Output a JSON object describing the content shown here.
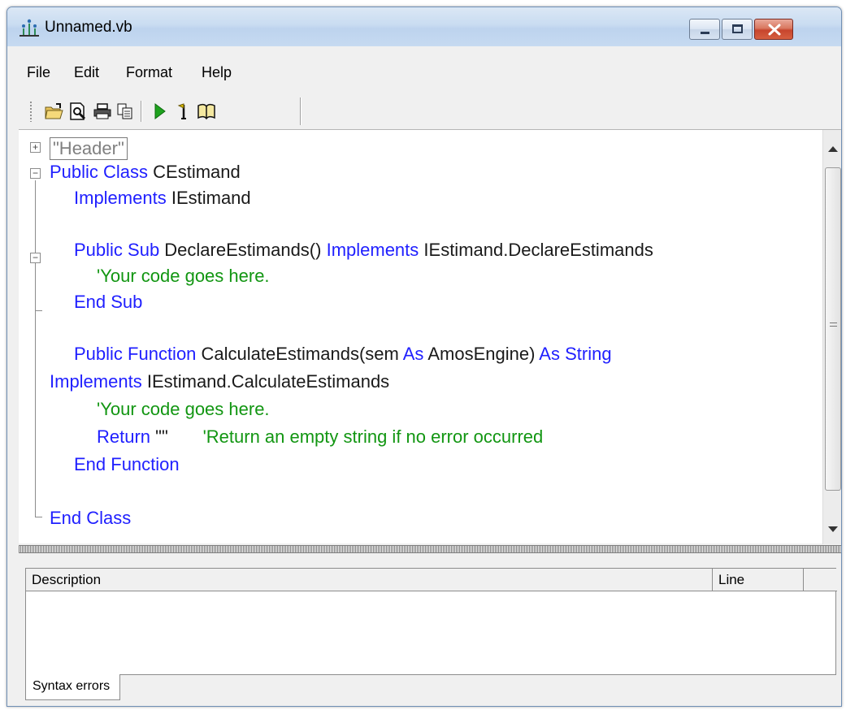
{
  "window": {
    "title": "Unnamed.vb"
  },
  "menu": [
    "File",
    "Edit",
    "Format",
    "Help"
  ],
  "toolbar_icons": [
    "open-folder-icon",
    "print-preview-icon",
    "print-icon",
    "copy-icon",
    "run-icon",
    "step-icon",
    "help-book-icon"
  ],
  "editor": {
    "header_region": "\"Header\"",
    "lines": [
      [
        {
          "t": "Public Class ",
          "c": "kw"
        },
        {
          "t": "CEstimand",
          "c": "tx"
        }
      ],
      [
        {
          "t": "Implements ",
          "c": "kw"
        },
        {
          "t": "IEstimand",
          "c": "tx"
        }
      ],
      [],
      [
        {
          "t": "Public Sub ",
          "c": "kw"
        },
        {
          "t": "DeclareEstimands() ",
          "c": "tx"
        },
        {
          "t": "Implements ",
          "c": "kw"
        },
        {
          "t": "IEstimand.DeclareEstimands",
          "c": "tx"
        }
      ],
      [
        {
          "t": "'Your code goes here.",
          "c": "cm"
        }
      ],
      [
        {
          "t": "End Sub",
          "c": "kw"
        }
      ],
      [],
      [
        {
          "t": "Public Function ",
          "c": "kw"
        },
        {
          "t": "CalculateEstimands(sem ",
          "c": "tx"
        },
        {
          "t": "As ",
          "c": "kw"
        },
        {
          "t": "AmosEngine) ",
          "c": "tx"
        },
        {
          "t": "As String",
          "c": "kw"
        }
      ],
      [
        {
          "t": "Implements ",
          "c": "kw"
        },
        {
          "t": "IEstimand.CalculateEstimands",
          "c": "tx"
        }
      ],
      [
        {
          "t": "'Your code goes here.",
          "c": "cm"
        }
      ],
      [
        {
          "t": "Return ",
          "c": "kw"
        },
        {
          "t": "\"\"",
          "c": "str"
        },
        {
          "t": "       'Return an empty string if no error occurred",
          "c": "cm"
        }
      ],
      [
        {
          "t": "End Function",
          "c": "kw"
        }
      ],
      [],
      [
        {
          "t": "End Class",
          "c": "kw"
        }
      ]
    ]
  },
  "errors_panel": {
    "columns": [
      "Description",
      "Line"
    ],
    "tab": "Syntax errors"
  },
  "colors": {
    "keyword": "#1f1fff",
    "comment": "#129612",
    "text": "#1a1a1a"
  }
}
